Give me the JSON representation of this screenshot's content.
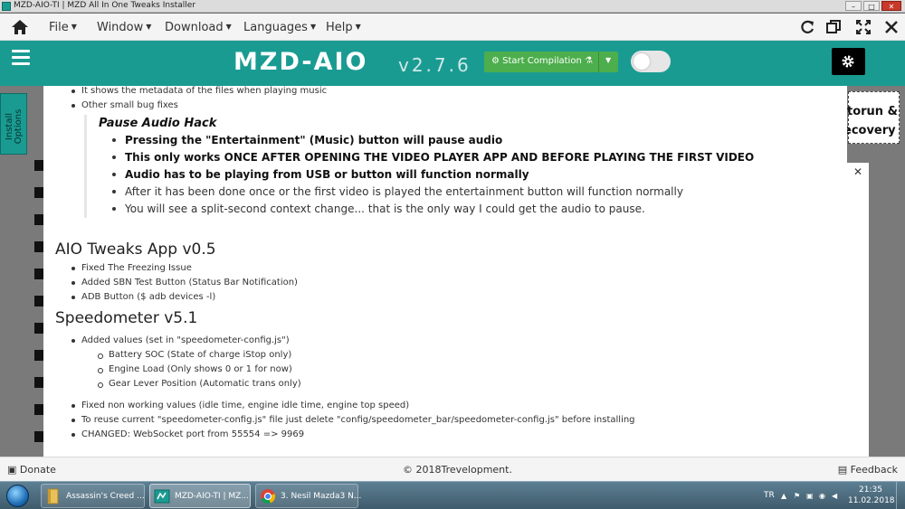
{
  "window": {
    "title": "MZD-AIO-TI | MZD All In One Tweaks Installer",
    "controls": [
      "–",
      "□",
      "✕"
    ]
  },
  "menu": {
    "items": [
      "File",
      "Window",
      "Download",
      "Languages",
      "Help"
    ]
  },
  "header": {
    "logo": "MZD-AIO",
    "version": "v2.7.6",
    "compile_label": "Start Compilation"
  },
  "sidebar": {
    "install_tab": "Install Options"
  },
  "background_text": {
    "line1": "torun &",
    "line2": "ecovery",
    "close": "✕"
  },
  "changelog": {
    "top_items": [
      "It shows the metadata of the files when playing music",
      "Other small bug fixes"
    ],
    "pause_audio": {
      "title": "Pause Audio Hack",
      "items": [
        "Pressing the \"Entertainment\" (Music) button will pause audio",
        "This only works ONCE AFTER OPENING THE VIDEO PLAYER APP AND BEFORE PLAYING THE FIRST VIDEO",
        "Audio has to be playing from USB or button will function normally",
        "After it has been done once or the first video is played the entertainment button will function normally",
        "You will see a split-second context change... that is the only way I could get the audio to pause."
      ]
    },
    "aio_tweaks": {
      "title": "AIO Tweaks App v0.5",
      "items": [
        "Fixed The Freezing Issue",
        "Added SBN Test Button (Status Bar Notification)",
        "ADB Button ($ adb devices -l)"
      ]
    },
    "speedometer": {
      "title": "Speedometer v5.1",
      "added": "Added values (set in \"speedometer-config.js\")",
      "sub_items": [
        "Battery SOC (State of charge iStop only)",
        "Engine Load (Only shows 0 or 1 for now)",
        "Gear Lever Position (Automatic trans only)"
      ],
      "items": [
        "Fixed non working values (idle time, engine idle time, engine top speed)",
        "To reuse current \"speedometer-config.js\" file just delete \"config/speedometer_bar/speedometer-config.js\" before installing",
        "CHANGED: WebSocket port from 55554 => 9969"
      ]
    }
  },
  "footer": {
    "donate": "Donate",
    "credit": "2018Trevelopment.",
    "feedback": "Feedback"
  },
  "taskbar": {
    "tasks": [
      "Assassin's Creed ...",
      "MZD-AIO-TI | MZ...",
      "3. Nesil Mazda3 N..."
    ],
    "lang": "TR",
    "time": "21:35",
    "date": "11.02.2018"
  }
}
